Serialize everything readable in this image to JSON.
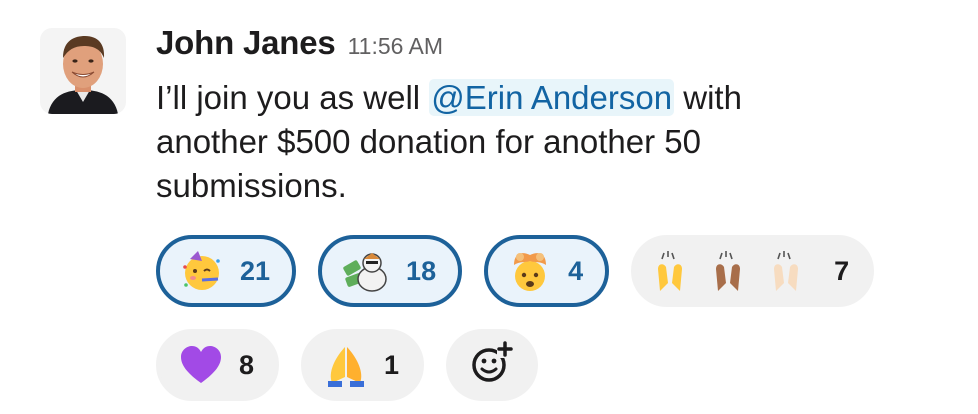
{
  "message": {
    "author": "John Janes",
    "timestamp": "11:56 AM",
    "text_before": "I’ll join you as well ",
    "mention": "@Erin Anderson",
    "text_after": " with another $500 donation for another 50 submissions."
  },
  "reactions": [
    {
      "icon": "partying-face-icon",
      "count": "21",
      "active": true
    },
    {
      "icon": "custom-money-character-icon",
      "count": "18",
      "active": true
    },
    {
      "icon": "exploding-head-icon",
      "count": "4",
      "active": true
    },
    {
      "icon": "raised-hands-multi-skin-tone-icon",
      "count": "7",
      "active": false
    },
    {
      "icon": "purple-heart-icon",
      "count": "8",
      "active": false
    },
    {
      "icon": "folded-hands-icon",
      "count": "1",
      "active": false
    }
  ],
  "add_reaction": {
    "icon": "add-reaction-icon"
  },
  "colors": {
    "mention_bg": "#e8f5fa",
    "mention_text": "#1264a3",
    "active_border": "#1d6199",
    "pill_bg": "#f1f1f1"
  }
}
